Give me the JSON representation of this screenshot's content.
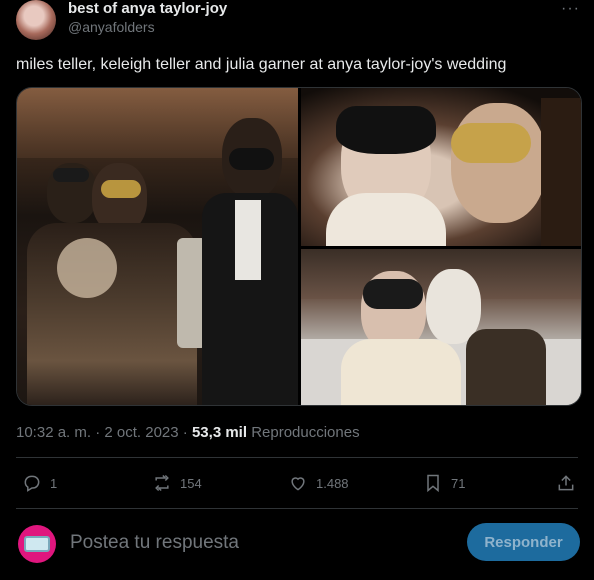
{
  "author": {
    "name": "best of anya taylor-joy",
    "handle": "@anyafolders"
  },
  "post": {
    "text": "miles teller, keleigh teller and julia garner at anya taylor-joy's wedding",
    "time": "10:32 a. m.",
    "date": "2 oct. 2023",
    "views_count": "53,3 mil",
    "views_label": "Reproducciones"
  },
  "actions": {
    "replies": "1",
    "reposts": "154",
    "likes": "1.488",
    "bookmarks": "71"
  },
  "reply": {
    "placeholder": "Postea tu respuesta",
    "button_label": "Responder"
  },
  "icons": [
    "more-icon",
    "reply-icon",
    "repost-icon",
    "like-icon",
    "bookmark-icon",
    "share-icon"
  ],
  "colors": {
    "background": "#000000",
    "text": "#e7e9ea",
    "muted": "#71767b",
    "accent_button": "#1d6b9e"
  }
}
